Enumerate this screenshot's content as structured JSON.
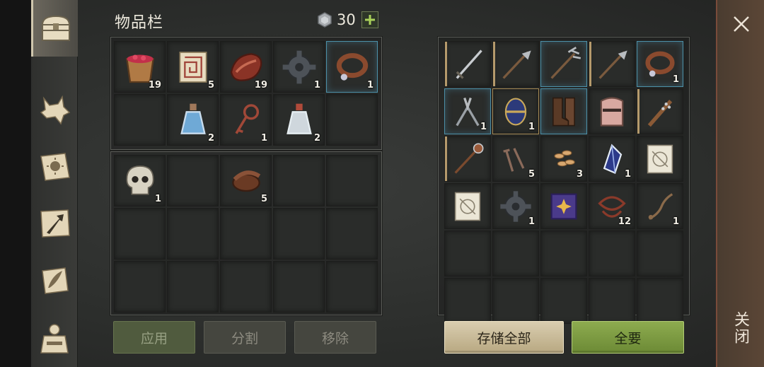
{
  "header": {
    "title": "物品栏",
    "currency_amount": "30"
  },
  "sidebar": {
    "tabs": [
      {
        "icon": "chest-icon",
        "active": true
      },
      {
        "icon": "wolf-head-icon",
        "active": false
      },
      {
        "icon": "sun-book-icon",
        "active": false
      },
      {
        "icon": "map-arrow-icon",
        "active": false
      },
      {
        "icon": "feather-scroll-icon",
        "active": false
      },
      {
        "icon": "character-outfit-icon",
        "active": false
      }
    ]
  },
  "inventory": {
    "backpack_slots": [
      {
        "icon": "berry-bucket-icon",
        "qty": "19"
      },
      {
        "icon": "maze-scroll-icon",
        "qty": "5"
      },
      {
        "icon": "raw-meat-icon",
        "qty": "19"
      },
      {
        "icon": "gear-icon",
        "qty": "1"
      },
      {
        "icon": "leather-collar-icon",
        "qty": "1",
        "highlight": true
      },
      {
        "icon": "",
        "qty": ""
      },
      {
        "icon": "water-flask-icon",
        "qty": "2"
      },
      {
        "icon": "ornate-key-icon",
        "qty": "1"
      },
      {
        "icon": "milk-flask-icon",
        "qty": "2"
      },
      {
        "icon": "",
        "qty": ""
      }
    ],
    "pocket_slots": [
      {
        "icon": "skull-icon",
        "qty": "1"
      },
      {
        "icon": "",
        "qty": ""
      },
      {
        "icon": "leather-roll-icon",
        "qty": "5"
      },
      {
        "icon": "",
        "qty": ""
      },
      {
        "icon": "",
        "qty": ""
      },
      {
        "icon": "",
        "qty": ""
      },
      {
        "icon": "",
        "qty": ""
      },
      {
        "icon": "",
        "qty": ""
      },
      {
        "icon": "",
        "qty": ""
      },
      {
        "icon": "",
        "qty": ""
      },
      {
        "icon": "",
        "qty": ""
      },
      {
        "icon": "",
        "qty": ""
      },
      {
        "icon": "",
        "qty": ""
      },
      {
        "icon": "",
        "qty": ""
      },
      {
        "icon": "",
        "qty": ""
      }
    ],
    "buttons": {
      "use": "应用",
      "split": "分割",
      "remove": "移除"
    }
  },
  "storage": {
    "slots": [
      {
        "icon": "sword-icon",
        "qty": "",
        "style": "tan"
      },
      {
        "icon": "halberd-icon",
        "qty": "",
        "style": "tan"
      },
      {
        "icon": "trident-icon",
        "qty": "",
        "style": "hl"
      },
      {
        "icon": "halberd-icon",
        "qty": "",
        "style": "tan"
      },
      {
        "icon": "leather-collar-icon",
        "qty": "1",
        "style": "hl"
      },
      {
        "icon": "pliers-icon",
        "qty": "1",
        "style": "hl"
      },
      {
        "icon": "egg-icon",
        "qty": "1",
        "style": "gold"
      },
      {
        "icon": "leather-boots-icon",
        "qty": "",
        "style": "hl"
      },
      {
        "icon": "great-helm-icon",
        "qty": "",
        "style": ""
      },
      {
        "icon": "spiked-club-icon",
        "qty": "",
        "style": "tan"
      },
      {
        "icon": "mace-staff-icon",
        "qty": "",
        "style": "tan"
      },
      {
        "icon": "nails-icon",
        "qty": "5",
        "style": ""
      },
      {
        "icon": "seeds-icon",
        "qty": "3",
        "style": ""
      },
      {
        "icon": "crystal-shard-icon",
        "qty": "1",
        "style": ""
      },
      {
        "icon": "blueprint-scroll-icon",
        "qty": "",
        "style": ""
      },
      {
        "icon": "blueprint-scroll-icon",
        "qty": "",
        "style": ""
      },
      {
        "icon": "gear-icon",
        "qty": "1",
        "style": ""
      },
      {
        "icon": "spell-book-icon",
        "qty": "",
        "style": ""
      },
      {
        "icon": "tangled-roots-icon",
        "qty": "12",
        "style": ""
      },
      {
        "icon": "rope-icon",
        "qty": "1",
        "style": ""
      },
      {
        "icon": "",
        "qty": "",
        "style": ""
      },
      {
        "icon": "",
        "qty": "",
        "style": ""
      },
      {
        "icon": "",
        "qty": "",
        "style": ""
      },
      {
        "icon": "",
        "qty": "",
        "style": ""
      },
      {
        "icon": "",
        "qty": "",
        "style": ""
      },
      {
        "icon": "",
        "qty": "",
        "style": ""
      },
      {
        "icon": "",
        "qty": "",
        "style": ""
      },
      {
        "icon": "",
        "qty": "",
        "style": ""
      },
      {
        "icon": "",
        "qty": "",
        "style": ""
      },
      {
        "icon": "",
        "qty": "",
        "style": ""
      }
    ],
    "buttons": {
      "store_all": "存储全部",
      "take_all": "全要"
    }
  },
  "closebar": {
    "label": "关闭"
  }
}
